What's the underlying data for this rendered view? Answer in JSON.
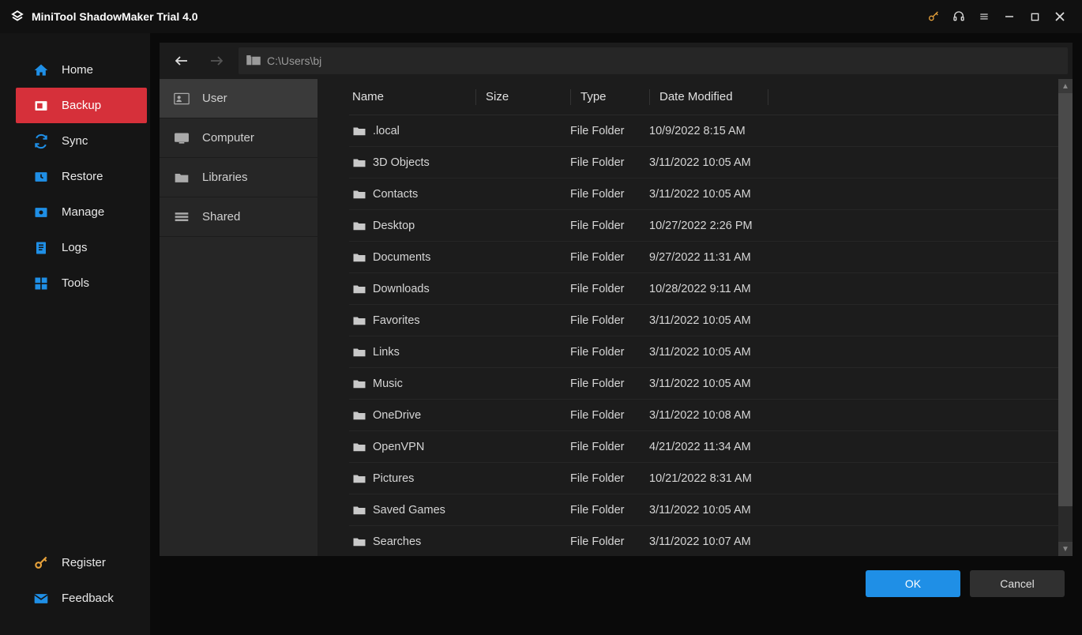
{
  "titlebar": {
    "title": "MiniTool ShadowMaker Trial 4.0"
  },
  "sidebar": {
    "items": [
      {
        "label": "Home",
        "icon": "home-icon",
        "color": "#1f8fe6",
        "active": false
      },
      {
        "label": "Backup",
        "icon": "backup-icon",
        "color": "#ffffff",
        "active": true
      },
      {
        "label": "Sync",
        "icon": "sync-icon",
        "color": "#1f8fe6",
        "active": false
      },
      {
        "label": "Restore",
        "icon": "restore-icon",
        "color": "#1f8fe6",
        "active": false
      },
      {
        "label": "Manage",
        "icon": "manage-icon",
        "color": "#1f8fe6",
        "active": false
      },
      {
        "label": "Logs",
        "icon": "logs-icon",
        "color": "#1f8fe6",
        "active": false
      },
      {
        "label": "Tools",
        "icon": "tools-icon",
        "color": "#1f8fe6",
        "active": false
      }
    ],
    "bottom": [
      {
        "label": "Register",
        "icon": "key-icon",
        "color": "#e9a33b"
      },
      {
        "label": "Feedback",
        "icon": "mail-icon",
        "color": "#1f8fe6"
      }
    ]
  },
  "browser": {
    "path": "C:\\Users\\bj",
    "tree": [
      {
        "label": "User",
        "icon": "user-card-icon",
        "selected": true
      },
      {
        "label": "Computer",
        "icon": "computer-icon",
        "selected": false
      },
      {
        "label": "Libraries",
        "icon": "folder-icon",
        "selected": false
      },
      {
        "label": "Shared",
        "icon": "shared-icon",
        "selected": false
      }
    ],
    "columns": {
      "name": "Name",
      "size": "Size",
      "type": "Type",
      "date": "Date Modified"
    },
    "rows": [
      {
        "name": ".local",
        "type": "File Folder",
        "date": "10/9/2022 8:15 AM"
      },
      {
        "name": "3D Objects",
        "type": "File Folder",
        "date": "3/11/2022 10:05 AM"
      },
      {
        "name": "Contacts",
        "type": "File Folder",
        "date": "3/11/2022 10:05 AM"
      },
      {
        "name": "Desktop",
        "type": "File Folder",
        "date": "10/27/2022 2:26 PM"
      },
      {
        "name": "Documents",
        "type": "File Folder",
        "date": "9/27/2022 11:31 AM"
      },
      {
        "name": "Downloads",
        "type": "File Folder",
        "date": "10/28/2022 9:11 AM"
      },
      {
        "name": "Favorites",
        "type": "File Folder",
        "date": "3/11/2022 10:05 AM"
      },
      {
        "name": "Links",
        "type": "File Folder",
        "date": "3/11/2022 10:05 AM"
      },
      {
        "name": "Music",
        "type": "File Folder",
        "date": "3/11/2022 10:05 AM"
      },
      {
        "name": "OneDrive",
        "type": "File Folder",
        "date": "3/11/2022 10:08 AM"
      },
      {
        "name": "OpenVPN",
        "type": "File Folder",
        "date": "4/21/2022 11:34 AM"
      },
      {
        "name": "Pictures",
        "type": "File Folder",
        "date": "10/21/2022 8:31 AM"
      },
      {
        "name": "Saved Games",
        "type": "File Folder",
        "date": "3/11/2022 10:05 AM"
      },
      {
        "name": "Searches",
        "type": "File Folder",
        "date": "3/11/2022 10:07 AM"
      }
    ]
  },
  "footer": {
    "ok": "OK",
    "cancel": "Cancel"
  }
}
